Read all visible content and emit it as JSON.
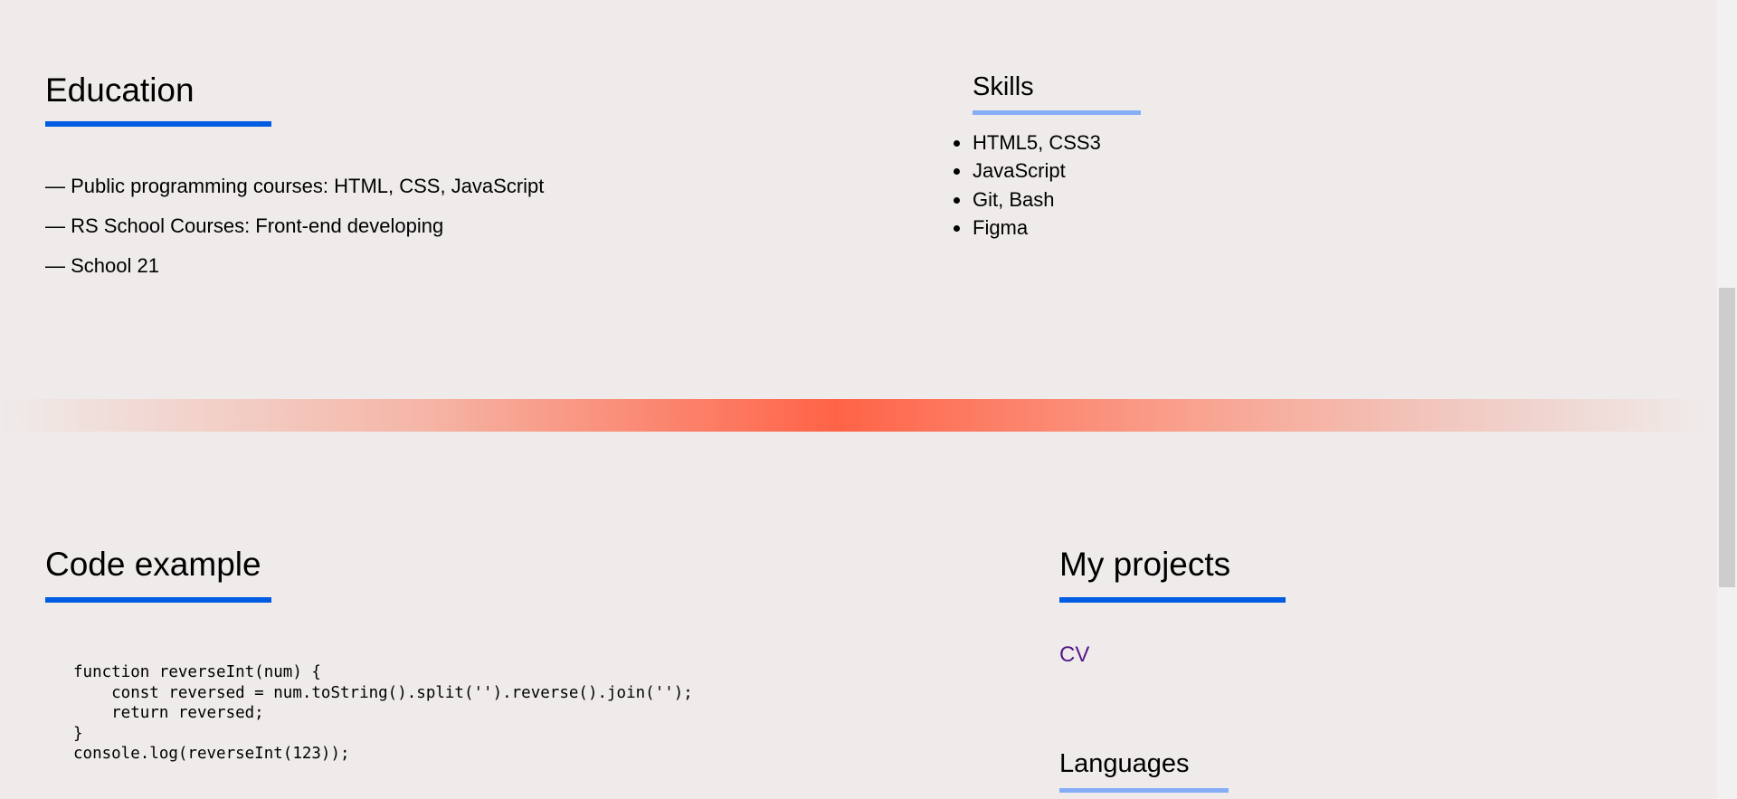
{
  "education": {
    "title": "Education",
    "items": [
      "— Public programming courses: HTML, CSS, JavaScript",
      "— RS School Courses: Front-end developing",
      "— School 21"
    ]
  },
  "skills": {
    "title": "Skills",
    "items": [
      "HTML5, CSS3",
      "JavaScript",
      "Git, Bash",
      "Figma"
    ]
  },
  "code_example": {
    "title": "Code example",
    "code": "function reverseInt(num) {\n    const reversed = num.toString().split('').reverse().join('');\n    return reversed;\n}\nconsole.log(reverseInt(123));"
  },
  "projects": {
    "title": "My projects",
    "links": [
      "CV"
    ]
  },
  "languages": {
    "title": "Languages"
  },
  "colors": {
    "accent": "#005ce0",
    "accent_light": "#86aef7",
    "divider": "#ff6347",
    "link": "#551a8b",
    "background": "#efebea"
  }
}
